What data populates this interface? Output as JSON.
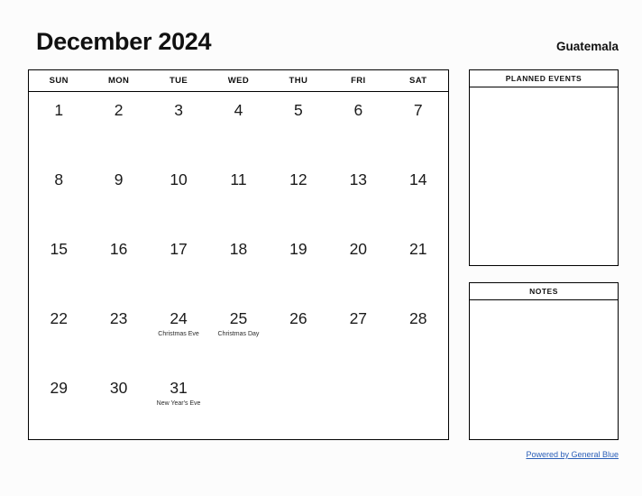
{
  "header": {
    "month_title": "December 2024",
    "country": "Guatemala"
  },
  "calendar": {
    "weekdays": [
      "SUN",
      "MON",
      "TUE",
      "WED",
      "THU",
      "FRI",
      "SAT"
    ],
    "weeks": [
      [
        {
          "day": "1",
          "event": ""
        },
        {
          "day": "2",
          "event": ""
        },
        {
          "day": "3",
          "event": ""
        },
        {
          "day": "4",
          "event": ""
        },
        {
          "day": "5",
          "event": ""
        },
        {
          "day": "6",
          "event": ""
        },
        {
          "day": "7",
          "event": ""
        }
      ],
      [
        {
          "day": "8",
          "event": ""
        },
        {
          "day": "9",
          "event": ""
        },
        {
          "day": "10",
          "event": ""
        },
        {
          "day": "11",
          "event": ""
        },
        {
          "day": "12",
          "event": ""
        },
        {
          "day": "13",
          "event": ""
        },
        {
          "day": "14",
          "event": ""
        }
      ],
      [
        {
          "day": "15",
          "event": ""
        },
        {
          "day": "16",
          "event": ""
        },
        {
          "day": "17",
          "event": ""
        },
        {
          "day": "18",
          "event": ""
        },
        {
          "day": "19",
          "event": ""
        },
        {
          "day": "20",
          "event": ""
        },
        {
          "day": "21",
          "event": ""
        }
      ],
      [
        {
          "day": "22",
          "event": ""
        },
        {
          "day": "23",
          "event": ""
        },
        {
          "day": "24",
          "event": "Christmas Eve"
        },
        {
          "day": "25",
          "event": "Christmas Day"
        },
        {
          "day": "26",
          "event": ""
        },
        {
          "day": "27",
          "event": ""
        },
        {
          "day": "28",
          "event": ""
        }
      ],
      [
        {
          "day": "29",
          "event": ""
        },
        {
          "day": "30",
          "event": ""
        },
        {
          "day": "31",
          "event": "New Year's Eve"
        },
        {
          "day": "",
          "event": ""
        },
        {
          "day": "",
          "event": ""
        },
        {
          "day": "",
          "event": ""
        },
        {
          "day": "",
          "event": ""
        }
      ]
    ]
  },
  "panels": {
    "planned_events_title": "PLANNED EVENTS",
    "notes_title": "NOTES"
  },
  "footer": {
    "link_text": "Powered by General Blue",
    "link_color": "#2b5fb8"
  }
}
